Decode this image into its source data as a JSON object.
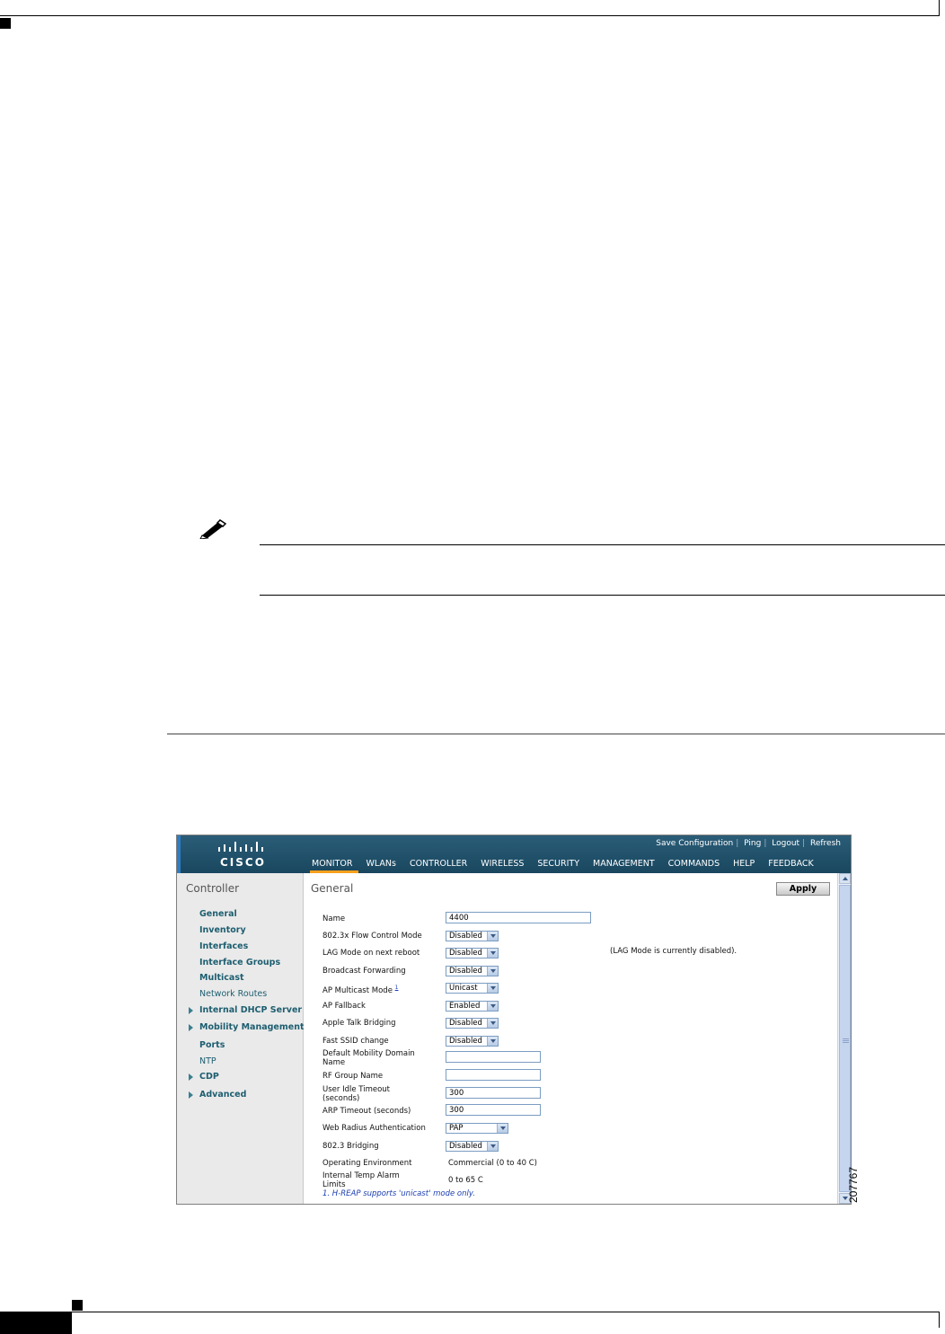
{
  "figure": {
    "id": "207767"
  },
  "ui": {
    "toplinks": [
      "Save Configuration",
      "Ping",
      "Logout",
      "Refresh"
    ],
    "logo": "CISCO",
    "menu": [
      "MONITOR",
      "WLANs",
      "CONTROLLER",
      "WIRELESS",
      "SECURITY",
      "MANAGEMENT",
      "COMMANDS",
      "HELP",
      "FEEDBACK"
    ],
    "active_menu": "MONITOR",
    "sidebar": {
      "title": "Controller",
      "items": [
        {
          "label": "General",
          "expandable": false
        },
        {
          "label": "Inventory",
          "expandable": false
        },
        {
          "label": "Interfaces",
          "expandable": false
        },
        {
          "label": "Interface Groups",
          "expandable": false
        },
        {
          "label": "Multicast",
          "expandable": false
        },
        {
          "label": "Network Routes",
          "expandable": false
        },
        {
          "label": "Internal DHCP Server",
          "expandable": true
        },
        {
          "label": "Mobility Management",
          "expandable": true
        },
        {
          "label": "Ports",
          "expandable": false
        },
        {
          "label": "NTP",
          "expandable": false
        },
        {
          "label": "CDP",
          "expandable": true
        },
        {
          "label": "Advanced",
          "expandable": true
        }
      ]
    },
    "main": {
      "title": "General",
      "apply_label": "Apply",
      "lag_note": "(LAG Mode is currently disabled).",
      "footnote": "1. H-REAP supports 'unicast' mode only.",
      "rows": [
        {
          "label": "Name",
          "value": "4400"
        },
        {
          "label": "802.3x Flow Control Mode",
          "value": "Disabled"
        },
        {
          "label": "LAG Mode on next reboot",
          "value": "Disabled"
        },
        {
          "label": "Broadcast Forwarding",
          "value": "Disabled"
        },
        {
          "label": "AP Multicast Mode",
          "sup": "1",
          "value": "Unicast"
        },
        {
          "label": "AP Fallback",
          "value": "Enabled"
        },
        {
          "label": "Apple Talk Bridging",
          "value": "Disabled"
        },
        {
          "label": "Fast SSID change",
          "value": "Disabled"
        },
        {
          "label": "Default Mobility Domain Name",
          "value": ""
        },
        {
          "label": "RF Group Name",
          "value": ""
        },
        {
          "label": "User Idle Timeout (seconds)",
          "value": "300"
        },
        {
          "label": "ARP Timeout (seconds)",
          "value": "300"
        },
        {
          "label": "Web Radius Authentication",
          "value": "PAP"
        },
        {
          "label": "802.3 Bridging",
          "value": "Disabled"
        },
        {
          "label": "Operating Environment",
          "value": "Commercial (0 to 40 C)"
        },
        {
          "label": "Internal Temp Alarm Limits",
          "value": "0 to 65 C"
        }
      ]
    }
  },
  "colors": {
    "topbar": "#1f4f68",
    "menu_active_underline": "#f7a01d",
    "sidebar_link": "#1d5e70",
    "footnote": "#1a3db0"
  }
}
